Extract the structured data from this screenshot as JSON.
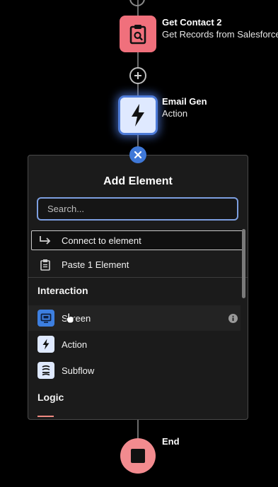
{
  "canvas": {
    "nodes": [
      {
        "title": "Get Contact 2",
        "subtitle": "Get Records from Salesforce",
        "icon": "clipboard-search-icon",
        "color": "#f0707c"
      },
      {
        "title": "Email Gen",
        "subtitle": "Action",
        "icon": "lightning-bolt-icon",
        "color": "#dfe9ff"
      }
    ],
    "end": {
      "title": "End",
      "icon": "stop-square-icon",
      "color": "#f28b8f"
    }
  },
  "panel": {
    "title": "Add Element",
    "search_placeholder": "Search...",
    "connect_label": "Connect to element",
    "paste_label": "Paste 1 Element",
    "sections": [
      {
        "title": "Interaction",
        "items": [
          {
            "label": "Screen",
            "icon": "screen-icon",
            "color": "#3d7fe0"
          },
          {
            "label": "Action",
            "icon": "lightning-bolt-icon",
            "color": "#dfe9ff"
          },
          {
            "label": "Subflow",
            "icon": "subflow-icon",
            "color": "#dfe9ff"
          }
        ]
      },
      {
        "title": "Logic",
        "items": []
      }
    ]
  }
}
